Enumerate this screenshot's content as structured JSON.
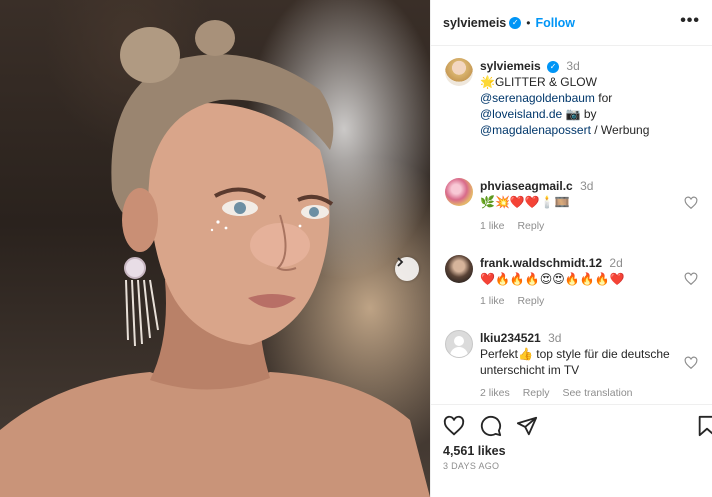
{
  "post": {
    "username": "sylviemeis",
    "follow_label": "Follow",
    "separator": "•",
    "verified_glyph": "✓"
  },
  "caption": {
    "username": "sylviemeis",
    "time": "3d",
    "line1": "🌟GLITTER & GLOW",
    "mention1": "@serenagoldenbaum",
    "line2_suffix": " for",
    "mention2": "@loveisland.de",
    "line3_suffix": " 📷 by",
    "mention3": "@magdalenapossert",
    "line4_suffix": " / Werbung"
  },
  "comments": [
    {
      "username": "phviaseagmail.c",
      "time": "3d",
      "text": "🌿💥❤️❤️🕯️🎞️",
      "likes": "1 like",
      "reply": "Reply"
    },
    {
      "username": "frank.waldschmidt.12",
      "time": "2d",
      "text": "❤️🔥🔥🔥😍😍🔥🔥🔥❤️",
      "likes": "1 like",
      "reply": "Reply"
    },
    {
      "username": "lkiu234521",
      "time": "3d",
      "text": "Perfekt👍 top style für die deutsche unterschicht im TV",
      "likes": "2 likes",
      "reply": "Reply",
      "translate": "See translation"
    }
  ],
  "footer": {
    "likes": "4,561 likes",
    "date": "3 DAYS AGO"
  },
  "icons": {
    "more": "more-options-icon",
    "like": "heart-icon",
    "comment": "comment-icon",
    "share": "share-icon",
    "save": "bookmark-icon",
    "next": "chevron-right-icon"
  },
  "colors": {
    "link": "#00376b",
    "accent": "#0095f6",
    "muted": "#8e8e8e",
    "text": "#262626"
  }
}
